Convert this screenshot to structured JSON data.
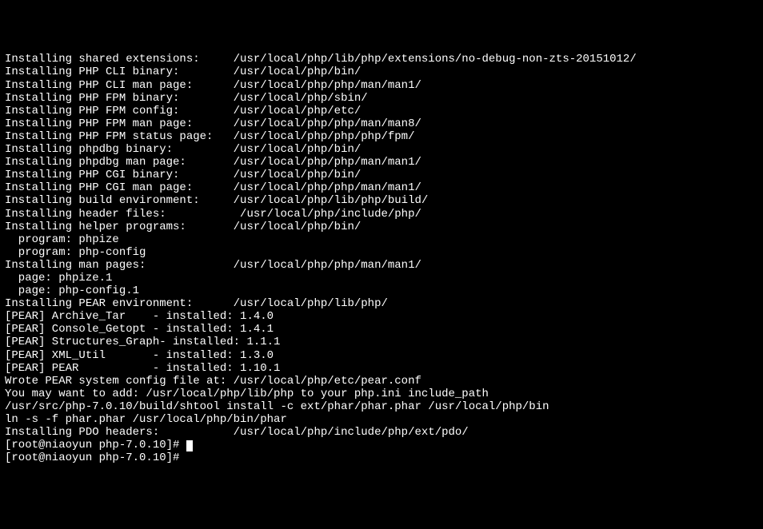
{
  "lines": [
    "Installing shared extensions:     /usr/local/php/lib/php/extensions/no-debug-non-zts-20151012/",
    "Installing PHP CLI binary:        /usr/local/php/bin/",
    "Installing PHP CLI man page:      /usr/local/php/php/man/man1/",
    "Installing PHP FPM binary:        /usr/local/php/sbin/",
    "Installing PHP FPM config:        /usr/local/php/etc/",
    "Installing PHP FPM man page:      /usr/local/php/php/man/man8/",
    "Installing PHP FPM status page:   /usr/local/php/php/php/fpm/",
    "Installing phpdbg binary:         /usr/local/php/bin/",
    "Installing phpdbg man page:       /usr/local/php/php/man/man1/",
    "Installing PHP CGI binary:        /usr/local/php/bin/",
    "Installing PHP CGI man page:      /usr/local/php/php/man/man1/",
    "Installing build environment:     /usr/local/php/lib/php/build/",
    "Installing header files:           /usr/local/php/include/php/",
    "Installing helper programs:       /usr/local/php/bin/",
    "  program: phpize",
    "  program: php-config",
    "Installing man pages:             /usr/local/php/php/man/man1/",
    "  page: phpize.1",
    "  page: php-config.1",
    "Installing PEAR environment:      /usr/local/php/lib/php/",
    "[PEAR] Archive_Tar    - installed: 1.4.0",
    "[PEAR] Console_Getopt - installed: 1.4.1",
    "[PEAR] Structures_Graph- installed: 1.1.1",
    "[PEAR] XML_Util       - installed: 1.3.0",
    "[PEAR] PEAR           - installed: 1.10.1",
    "Wrote PEAR system config file at: /usr/local/php/etc/pear.conf",
    "You may want to add: /usr/local/php/lib/php to your php.ini include_path",
    "/usr/src/php-7.0.10/build/shtool install -c ext/phar/phar.phar /usr/local/php/bin",
    "ln -s -f phar.phar /usr/local/php/bin/phar",
    "Installing PDO headers:           /usr/local/php/include/php/ext/pdo/"
  ],
  "prompt": "[root@niaoyun php-7.0.10]#",
  "partial_line": "[root@niaoyun php-7.0.10]#"
}
